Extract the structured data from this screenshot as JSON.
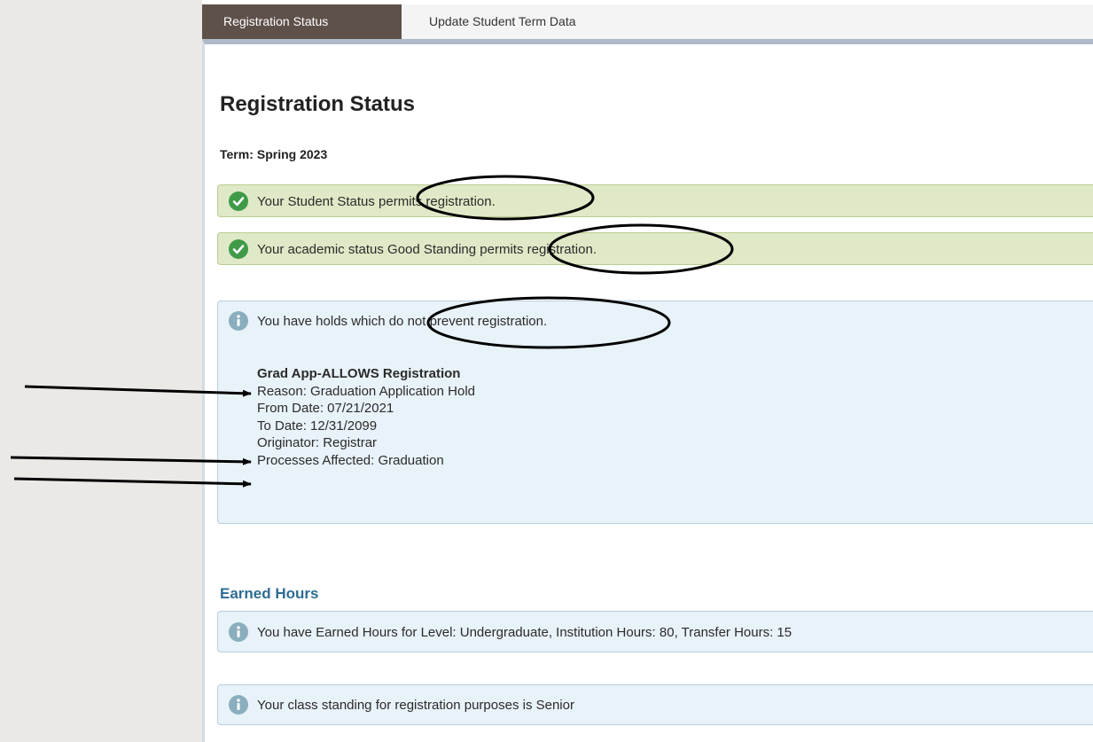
{
  "tabs": [
    {
      "label": "Registration Status",
      "active": true
    },
    {
      "label": "Update Student Term Data",
      "active": false
    }
  ],
  "page_title": "Registration Status",
  "term": {
    "label": "Term:",
    "value": "Spring 2023"
  },
  "messages": {
    "student_status": "Your Student Status permits registration.",
    "academic_status": "Your academic status Good Standing permits registration.",
    "holds_intro": "You have holds which do not prevent registration."
  },
  "hold": {
    "title": "Grad App-ALLOWS Registration",
    "reason": "Reason: Graduation Application Hold",
    "from_date": "From Date: 07/21/2021",
    "to_date": "To Date: 12/31/2099",
    "originator": "Originator: Registrar",
    "processes": "Processes Affected: Graduation"
  },
  "earned_hours": {
    "section_title": "Earned Hours",
    "message": "You have Earned Hours for Level: Undergraduate, Institution Hours: 80, Transfer Hours: 15"
  },
  "class_standing": {
    "message": "Your class standing for registration purposes is Senior"
  },
  "colors": {
    "success_bg": "#dfe9c7",
    "info_bg": "#e8f2f9",
    "active_tab_bg": "#5e514a",
    "section_title": "#2e6c93"
  },
  "icons": {
    "success": "check-circle-icon",
    "info": "info-circle-icon"
  }
}
